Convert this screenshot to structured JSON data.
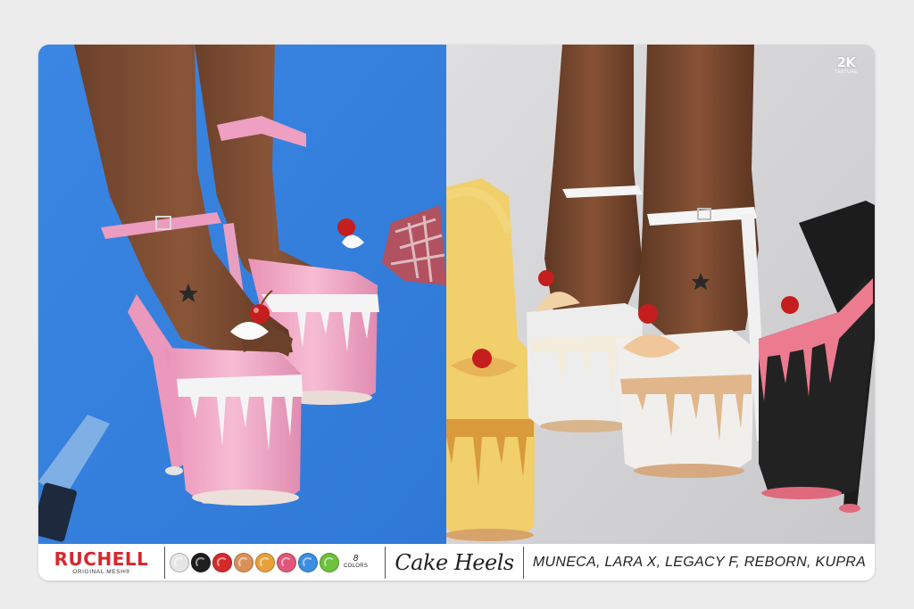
{
  "brand": {
    "name": "RUCHELL",
    "subtitle": "ORIGINAL MESH®",
    "color": "#d8262e"
  },
  "badge": {
    "big": "2K",
    "small": "TEXTURE"
  },
  "colors": {
    "count": "8",
    "label": "COLORS",
    "swatches": [
      {
        "name": "white",
        "hex": "#e6e6e6"
      },
      {
        "name": "black",
        "hex": "#1e1e1e"
      },
      {
        "name": "red",
        "hex": "#d42a2a"
      },
      {
        "name": "caramel",
        "hex": "#d9915a"
      },
      {
        "name": "orange",
        "hex": "#e8a13a"
      },
      {
        "name": "pink",
        "hex": "#e0577a"
      },
      {
        "name": "blue",
        "hex": "#3a8ee0"
      },
      {
        "name": "green",
        "hex": "#6cc13d"
      }
    ]
  },
  "product_title": "Cake Heels",
  "compatible_bodies": "MUNECA, LARA X, LEGACY F, REBORN, KUPRA",
  "palette": {
    "left_bg": "#3a86e2",
    "right_bg": "#d6d6d8",
    "pink_shoe": "#f0a8c6",
    "drip": "#f2f2f2"
  }
}
